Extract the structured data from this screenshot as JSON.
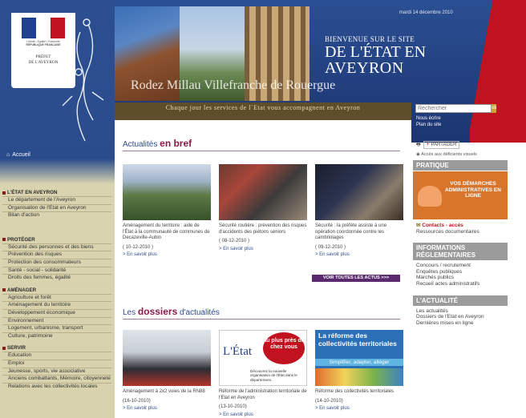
{
  "colors": {
    "header_blue": "#2b4f93",
    "accent_red": "#c1121f",
    "menu_beige": "#d8d2ad",
    "tagline_brown": "#5e4e2a",
    "title_purple": "#8c1a4b",
    "button_purple": "#5b2a6e",
    "promo_orange": "#d9742b"
  },
  "header": {
    "date": "mardi 14 décembre 2010",
    "welcome_line1": "BIENVENUE SUR LE SITE",
    "welcome_line2": "DE L'ÉTAT EN",
    "welcome_line3": "AVEYRON",
    "towns": "Rodez Millau Villefranche de Rouergue",
    "tagline": "Chaque jour les services de l`Etat vous accompagnent en Aveyron"
  },
  "logo": {
    "marianne": "Liberté • Égalité • Fraternité",
    "republique": "RÉPUBLIQUE FRANÇAISE",
    "prefet_line1": "PRÉFET",
    "prefet_line2": "DE L'AVEYRON"
  },
  "nav": {
    "accueil": "Accueil",
    "home_icon": "home-icon"
  },
  "search": {
    "placeholder": "Rechercher",
    "button": "ok",
    "link1": "Nous écrire",
    "link2": "Plan du site"
  },
  "menu": [
    {
      "title": "L'ÉTAT EN AVEYRON",
      "items": [
        "Le département de l'Aveyron",
        "Organisation de l'Etat en Aveyron",
        "Bilan d'action"
      ]
    },
    {
      "title": "PROTÉGER",
      "items": [
        "Sécurité des personnes et des biens",
        "Prévention des risques",
        "Protection des consommateurs",
        "Santé - social - solidarité",
        "Droits des femmes, égalité"
      ]
    },
    {
      "title": "AMÉNAGER",
      "items": [
        "Agriculture et forêt",
        "Aménagement du territoire",
        "Développement économique",
        "Environnement",
        "Logement, urbanisme, transport",
        "Culture, patrimoine"
      ]
    },
    {
      "title": "SERVIR",
      "items": [
        "Education",
        "Emploi",
        "Jeunesse, sports, vie associative",
        "Anciens combattants, Mémoire, citoyenneté",
        "Relations avec les collectivités locales"
      ]
    }
  ],
  "bref": {
    "title_a": "Actualités",
    "title_b": "en bref",
    "cards": [
      {
        "text": "Aménagement du territoire : aide de l'État à la communauté de communes de Decazeville-Aubin",
        "date": "( 10-12-2010 )",
        "more": "> En savoir plus"
      },
      {
        "text": "Sécurité routière : prévention des risques d'accidents des piétons seniors",
        "date": "( 08-12-2010 )",
        "more": "> En savoir plus"
      },
      {
        "text": "Sécurité : la préfète assiste à une opération coordonnée contre les cambriolages",
        "date": "( 09-12-2010 )",
        "more": "> En savoir plus"
      }
    ],
    "all_button": "VOIR TOUTES LES ACTUS >>>"
  },
  "dossiers": {
    "title_a": "Les",
    "title_b": "dossiers",
    "title_c": "d'actualités",
    "cards": [
      {
        "text": "Aménagement à 2x2 voies de la RN88",
        "date": "(16-10-2010)",
        "more": "> En savoir plus"
      },
      {
        "text": "Réforme de l'administration territoriale de l'Etat en Aveyron",
        "date": "(13-10-2010)",
        "more": "> En savoir plus"
      },
      {
        "text": "Réforme des collectivités territoriales",
        "date": "(14-10-2010)",
        "more": "> En savoir plus"
      }
    ],
    "thumb2": {
      "l1": "L'État",
      "l2": "au plus près de chez vous",
      "l3": "Découvrez la nouvelle organisation de l'État dans le département."
    },
    "thumb3": {
      "l1": "La réforme des collectivités territoriales",
      "l2": "Simplifier, adapter, alléger"
    }
  },
  "right": {
    "share": "PARTAGER",
    "access": "Accès aux déficients visuels",
    "pratique": "PRATIQUE",
    "promo": "VOS DÉMARCHES ADMINISTRATIVES EN LIGNE",
    "contacts": "Contacts - accès",
    "ressources": "Ressources documentaires",
    "infos_title": "INFORMATIONS RÉGLEMENTAIRES",
    "infos": [
      "Concours / recrutement",
      "Enquêtes publiques",
      "Marchés publics",
      "Recueil actes administratifs"
    ],
    "actu_title": "L'ACTUALITÉ",
    "actu": [
      "Les actualités",
      "Dossiers de l'Etat en Aveyron",
      "Dernières mises en ligne"
    ]
  }
}
